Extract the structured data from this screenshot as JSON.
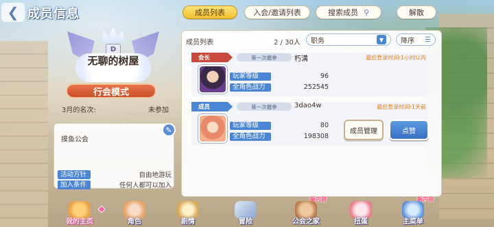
{
  "header": {
    "title": "成员信息",
    "tabs": [
      {
        "label": "成员列表",
        "active": true
      },
      {
        "label": "入会/邀请列表",
        "active": false
      },
      {
        "label": "搜索成员",
        "active": false,
        "icon": "search-icon"
      }
    ],
    "disband_label": "解散"
  },
  "guild": {
    "rank_letter": "D",
    "name": "无聊的树屋",
    "mode_label": "行会模式",
    "rank_label": "3月的名次:",
    "rank_value": "未参加",
    "description": "摸鱼公会",
    "policy_label": "活动方针",
    "policy_value": "自由地游玩",
    "join_label": "加入条件",
    "join_value": "任何人都可以加入"
  },
  "members": {
    "list_label": "成员列表",
    "count": "2 / 30人",
    "sort_label": "职务",
    "order_label": "降序",
    "cards": [
      {
        "role": "会长",
        "title_badge": "第一次握拳",
        "name": "朽溝",
        "last_login": "最后登录时间:1小时以内",
        "level_label": "玩家等级",
        "level": "96",
        "power_label": "全角色战力",
        "power": "252545"
      },
      {
        "role": "成员",
        "title_badge": "第一次握拳",
        "name": "3dao4w",
        "last_login": "最后登录时间:1天前",
        "level_label": "玩家等级",
        "level": "80",
        "power_label": "全角色战力",
        "power": "198308",
        "manage_label": "成员管理",
        "like_label": "点赞"
      }
    ]
  },
  "nav": {
    "items": [
      {
        "label": "我的主页",
        "active": true
      },
      {
        "label": "角色",
        "active": false
      },
      {
        "label": "剧情",
        "active": false
      },
      {
        "label": "冒险",
        "active": false
      },
      {
        "label": "公会之家",
        "active": false,
        "badge": "新内容"
      },
      {
        "label": "扭蛋",
        "active": false
      },
      {
        "label": "主菜单",
        "active": false,
        "badge": "新内容"
      }
    ]
  },
  "colors": {
    "accent_blue": "#4a86d4",
    "leader_red": "#c94a3c",
    "tab_gold": "#f0bf2e",
    "mode_orange": "#e8734a",
    "login_orange": "#d97a1f"
  }
}
